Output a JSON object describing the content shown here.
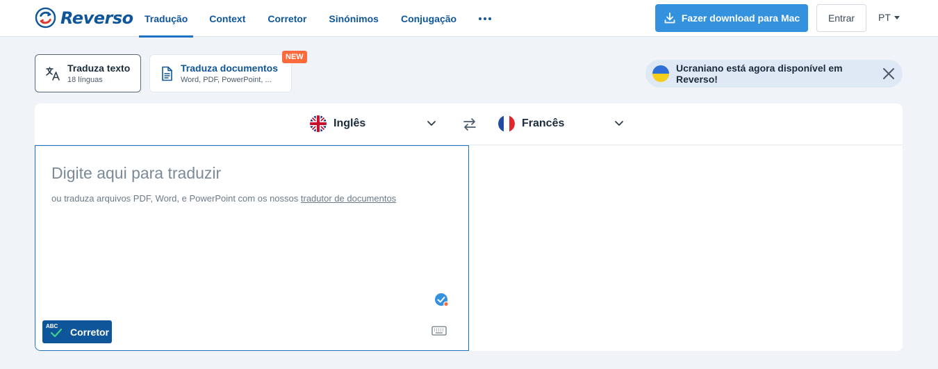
{
  "brand": {
    "name": "Reverso"
  },
  "nav": {
    "items": [
      {
        "label": "Tradução",
        "active": true
      },
      {
        "label": "Context",
        "active": false
      },
      {
        "label": "Corretor",
        "active": false
      },
      {
        "label": "Sinónimos",
        "active": false
      },
      {
        "label": "Conjugação",
        "active": false
      }
    ],
    "more_icon": "more-dots-icon"
  },
  "header": {
    "download_label": "Fazer download para Mac",
    "login_label": "Entrar",
    "language_code": "PT"
  },
  "modes": {
    "text": {
      "title": "Traduza texto",
      "subtitle": "18 línguas"
    },
    "documents": {
      "title": "Traduza documentos",
      "subtitle": "Word, PDF, PowerPoint, ...",
      "badge": "NEW"
    }
  },
  "notice": {
    "text": "Ucraniano está agora disponível em Reverso!"
  },
  "translator": {
    "source_language": "Inglês",
    "target_language": "Francês",
    "placeholder": "Digite aqui para traduzir",
    "hint_prefix": "ou traduza arquivos PDF, Word, e PowerPoint com os nossos ",
    "hint_link": "tradutor de documentos",
    "corretor_label": "Corretor",
    "corretor_badge": "ABC"
  },
  "colors": {
    "brand": "#0e5699",
    "accent": "#3391de",
    "new_badge": "#ff6a3d",
    "notice_bg": "#dfe9f5",
    "page_bg": "#f0f4f8"
  }
}
